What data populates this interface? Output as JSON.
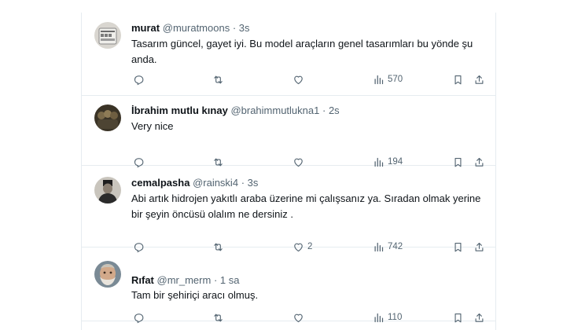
{
  "tweets": [
    {
      "name": "murat",
      "handle": "@muratmoons",
      "separator": "·",
      "time": "3s",
      "text": "Tasarım güncel, gayet iyi. Bu model araçların genel tasarımları bu yönde şu anda.",
      "replies": "",
      "retweets": "",
      "likes": "",
      "views": "570"
    },
    {
      "name": "İbrahim mutlu kınay",
      "handle": "@brahimmutlukna1",
      "separator": "·",
      "time": "2s",
      "text": "Very nice",
      "replies": "",
      "retweets": "",
      "likes": "",
      "views": "194"
    },
    {
      "name": "cemalpasha",
      "handle": "@rainski4",
      "separator": "·",
      "time": "3s",
      "text": "Abi artık hidrojen yakıtlı araba üzerine mi çalışsanız ya. Sıradan olmak yerine bir şeyin öncüsü olalım ne dersiniz .",
      "replies": "",
      "retweets": "",
      "likes": "2",
      "views": "742"
    },
    {
      "name": "Rıfat",
      "handle": "@mr_merm",
      "separator": "·",
      "time": "1 sa",
      "text": "Tam bir şehiriçi aracı olmuş.",
      "replies": "",
      "retweets": "",
      "likes": "",
      "views": "110"
    }
  ],
  "icons": {
    "reply": "reply-icon",
    "retweet": "retweet-icon",
    "like": "heart-icon",
    "views": "views-icon",
    "bookmark": "bookmark-icon",
    "share": "share-icon"
  },
  "colors": {
    "text": "#0f1419",
    "secondary": "#536471",
    "border": "#e6ecf0"
  }
}
